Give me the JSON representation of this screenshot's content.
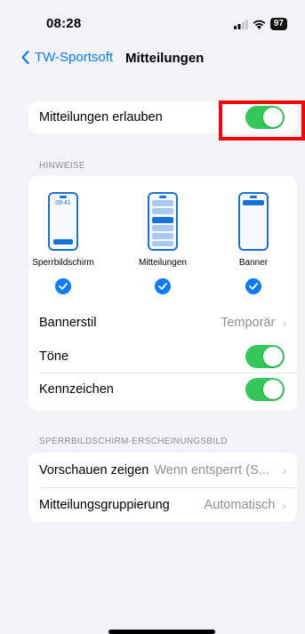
{
  "status": {
    "time": "08:28",
    "battery": "97"
  },
  "nav": {
    "back_label": "TW-Sportsoft",
    "title": "Mitteilungen"
  },
  "allow": {
    "label": "Mitteilungen erlauben",
    "on": true
  },
  "hinweise": {
    "header": "HINWEISE",
    "options": [
      {
        "label": "Sperrbildschirm",
        "time": "09:41",
        "checked": true
      },
      {
        "label": "Mitteilungen",
        "checked": true
      },
      {
        "label": "Banner",
        "checked": true
      }
    ],
    "rows": [
      {
        "label": "Bannerstil",
        "value": "Temporär"
      },
      {
        "label": "Töne",
        "on": true
      },
      {
        "label": "Kennzeichen",
        "on": true
      }
    ]
  },
  "lock": {
    "header": "SPERRBILDSCHIRM-ERSCHEINUNGSBILD",
    "rows": [
      {
        "label": "Vorschauen zeigen",
        "value": "Wenn entsperrt (S..."
      },
      {
        "label": "Mitteilungsgruppierung",
        "value": "Automatisch"
      }
    ]
  },
  "colors": {
    "accent": "#0a7cff",
    "toggle_on": "#34c759",
    "highlight": "#ff0000"
  },
  "icons": [
    "back-chevron-icon",
    "signal-icon",
    "wifi-icon",
    "battery-icon",
    "checkmark-icon",
    "chevron-right-icon"
  ]
}
